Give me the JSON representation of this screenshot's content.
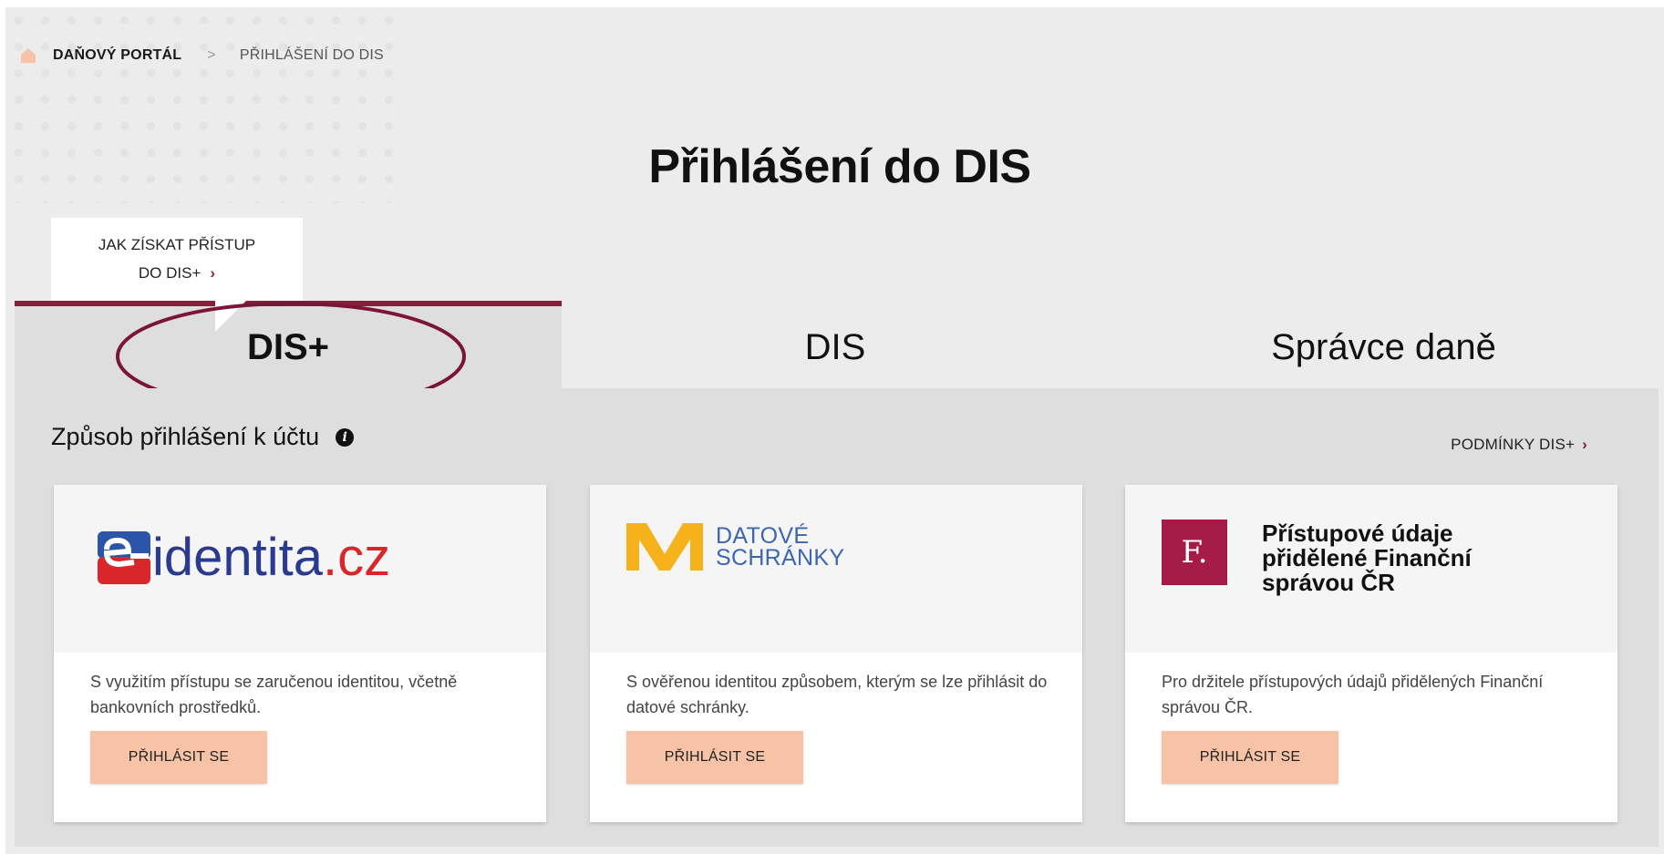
{
  "breadcrumb": {
    "home_icon": "home-icon",
    "item1": "DAŇOVÝ PORTÁL",
    "separator": ">",
    "item2": "PŘIHLÁŠENÍ DO DIS"
  },
  "page_title": "Přihlášení do DIS",
  "access_card": {
    "line1": "JAK ZÍSKAT PŘÍSTUP",
    "line2": "DO DIS+",
    "chevron": "›"
  },
  "tabs": [
    {
      "label": "DIS+",
      "active": true
    },
    {
      "label": "DIS",
      "active": false
    },
    {
      "label": "Správce daně",
      "active": false
    }
  ],
  "section": {
    "title": "Způsob přihlášení k účtu",
    "info_icon": "i",
    "conditions_link": "PODMÍNKY DIS+",
    "conditions_chevron": "›"
  },
  "cards": [
    {
      "logo_text": "identita",
      "logo_tld": ".cz",
      "description": "S využitím přístupu se zaručenou identitou, včetně bankovních prostředků.",
      "button": "PŘIHLÁSIT SE"
    },
    {
      "logo_line1": "DATOVÉ",
      "logo_line2": "SCHRÁNKY",
      "description": "S ověřenou identitou způsobem, kterým se lze přihlásit do datové schránky.",
      "button": "PŘIHLÁSIT SE"
    },
    {
      "logo_mark": "F.",
      "logo_text": "Přístupové údaje přidělené Finanční správou ČR",
      "description": "Pro držitele přístupových údajů přidělených Finanční správou ČR.",
      "button": "PŘIHLÁSIT SE"
    }
  ],
  "colors": {
    "accent": "#8c1d3a",
    "button": "#f6c3a6",
    "eidentita_blue": "#2a3a8f",
    "eidentita_red": "#d8262b",
    "datove_yellow": "#f5b21b",
    "datove_blue": "#3d66b0",
    "fs_red": "#a51c48"
  }
}
